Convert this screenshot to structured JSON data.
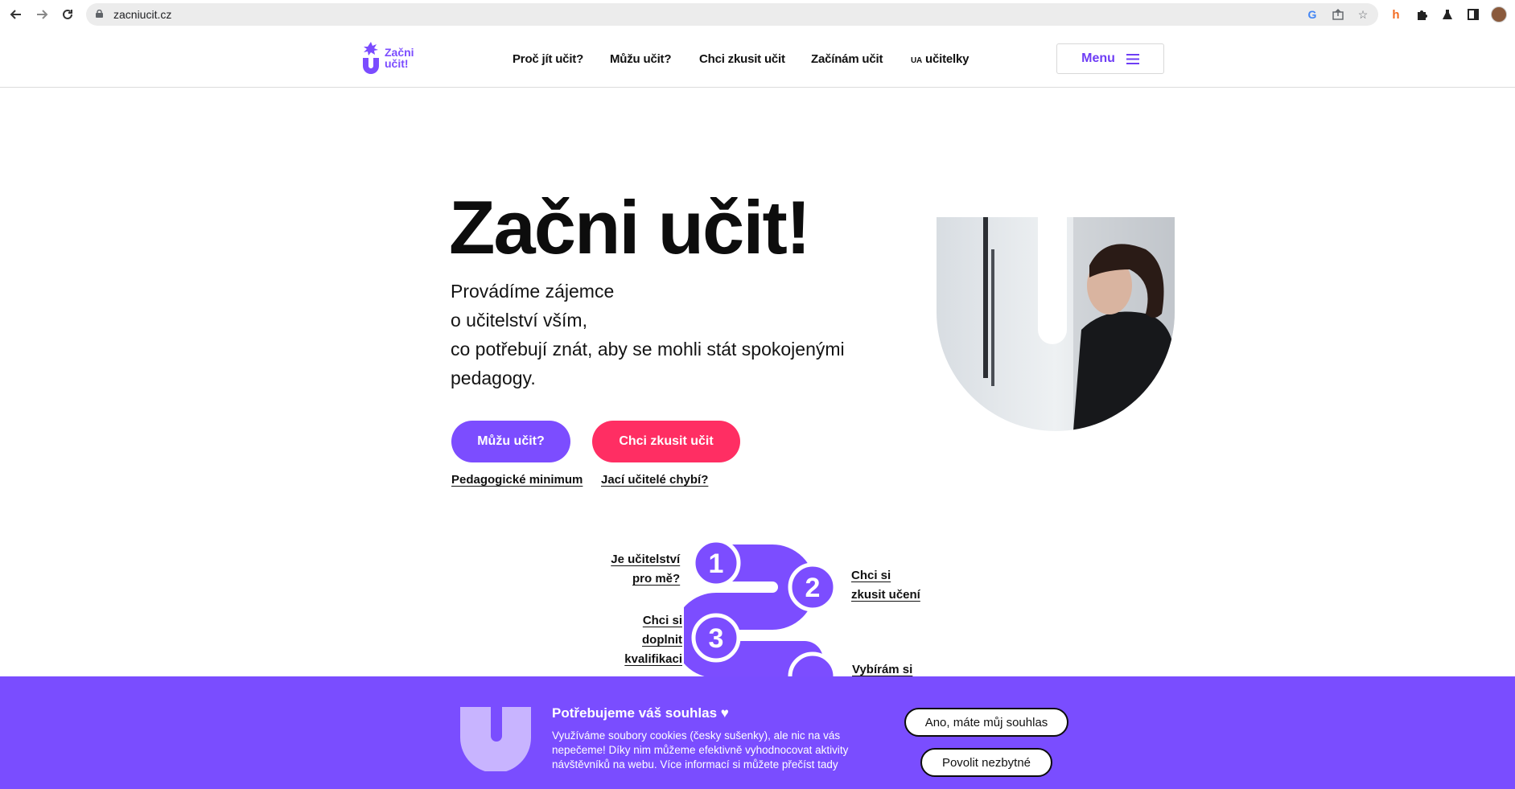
{
  "browser": {
    "url": "zacniucit.cz",
    "icons": [
      "back-icon",
      "forward-icon",
      "reload-icon",
      "lock-icon",
      "google-icon",
      "share-icon",
      "star-icon",
      "extension-honey-icon",
      "puzzle-icon",
      "labs-icon",
      "sidepanel-icon",
      "profile-avatar"
    ]
  },
  "header": {
    "logo_line1": "Začni",
    "logo_line2": "učit!",
    "nav": [
      "Proč jít učit?",
      "Můžu učit?",
      "Chci zkusit učit",
      "Začínám učit"
    ],
    "nav_ua_prefix": "UA",
    "nav_ua_label": "učitelky",
    "menu_label": "Menu"
  },
  "hero": {
    "title": "Začni učit!",
    "lines": [
      "Provádíme zájemce",
      "o učitelství vším,",
      "co potřebují znát, aby se mohli stát spokojenými",
      "pedagogy."
    ],
    "btn_primary": "Můžu učit?",
    "btn_secondary": "Chci zkusit učit",
    "link1": "Pedagogické minimum",
    "link2": "Jací učitelé chybí?"
  },
  "steps": {
    "numbers": [
      "1",
      "2",
      "3"
    ],
    "step1_lines": [
      "Je učitelství",
      "pro mě?"
    ],
    "step2_lines": [
      "Chci si",
      "zkusit učení"
    ],
    "step3_lines": [
      "Chci si",
      "doplnit",
      "kvalifikaci"
    ],
    "step4_lines": [
      "Vybírám si"
    ]
  },
  "cookie": {
    "title": "Potřebujeme váš souhlas ♥",
    "lines": [
      "Využíváme soubory cookies (česky sušenky), ale nic na vás",
      "nepečeme! Díky nim můžeme efektivně vyhodnocovat aktivity",
      "návštěvníků na webu. Více informací si můžete přečíst tady"
    ],
    "accept": "Ano, máte můj souhlas",
    "necessary": "Povolit nezbytné"
  },
  "colors": {
    "brand_purple": "#7c4dff",
    "brand_pink": "#ff2e63",
    "banner_purple": "#7a4dff"
  }
}
